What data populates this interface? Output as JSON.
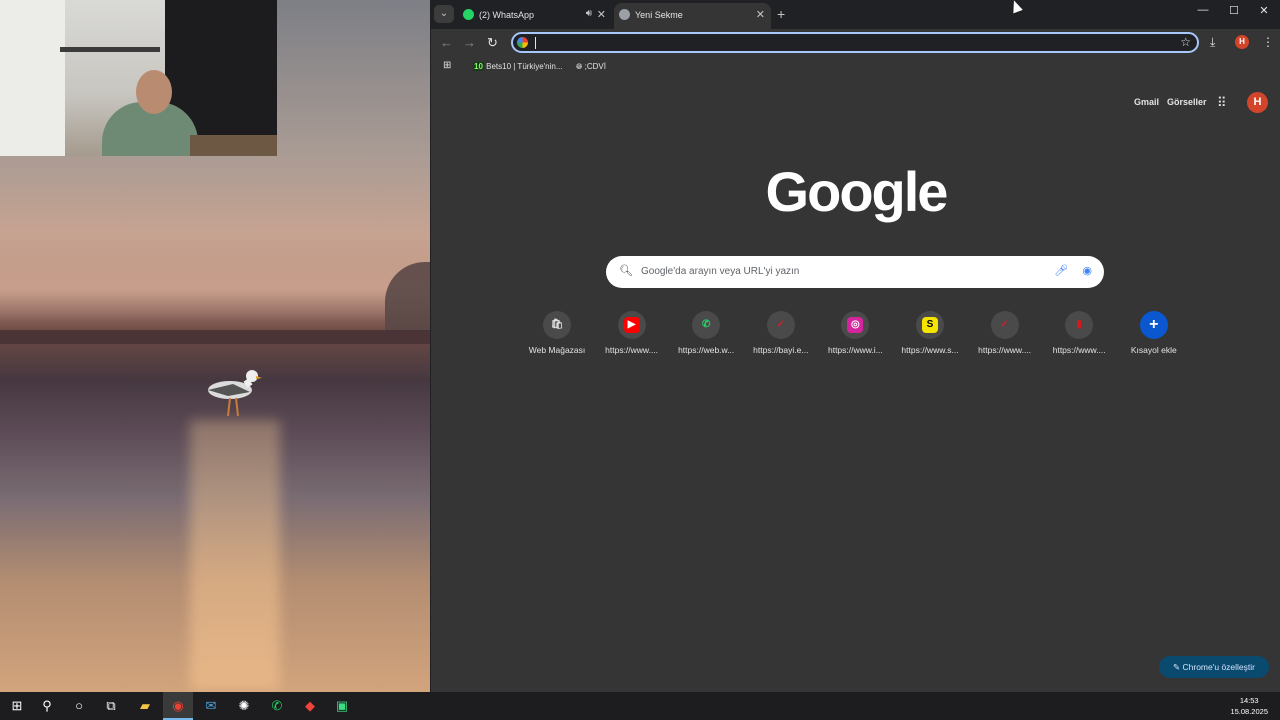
{
  "tabs": [
    {
      "title": "(2) WhatsApp",
      "icon": "whatsapp-icon",
      "audio": true
    },
    {
      "title": "Yeni Sekme",
      "icon": "chrome-icon",
      "active": true
    }
  ],
  "window_controls": {
    "minimize": "—",
    "maximize": "☐",
    "close": "✕"
  },
  "bookmarks": [
    {
      "icon": "10",
      "label": "Bets10 | Türkiye'nin..."
    },
    {
      "icon": "globe-icon",
      "label": ";CDVİ"
    }
  ],
  "top_links": {
    "gmail": "Gmail",
    "images": "Görseller",
    "profile_initial": "H"
  },
  "logo": "Google",
  "search": {
    "placeholder": "Google'da arayın veya URL'yi yazın"
  },
  "shortcuts": [
    {
      "label": "Web Mağazası",
      "icon": "web-store-icon",
      "glyph": "🛍",
      "color": "#e0e0e0"
    },
    {
      "label": "https://www....",
      "icon": "youtube-icon",
      "glyph": "▶",
      "color": "#ff0000"
    },
    {
      "label": "https://web.w...",
      "icon": "whatsapp-icon",
      "glyph": "✆",
      "color": "#25d366"
    },
    {
      "label": "https://bayi.e...",
      "icon": "checkmark-icon",
      "glyph": "✓",
      "color": "#c0272d"
    },
    {
      "label": "https://www.i...",
      "icon": "instagram-icon",
      "glyph": "◎",
      "color": "#d6249f"
    },
    {
      "label": "https://www.s...",
      "icon": "s-logo-icon",
      "glyph": "S",
      "color": "#f5e400"
    },
    {
      "label": "https://www....",
      "icon": "checkmark-icon",
      "glyph": "✓",
      "color": "#c0272d"
    },
    {
      "label": "https://www....",
      "icon": "red-square-icon",
      "glyph": "▮",
      "color": "#d41b1b"
    },
    {
      "label": "Kısayol ekle",
      "icon": "plus-icon",
      "glyph": "+",
      "color": "#0b57d0"
    }
  ],
  "customize_button": "Chrome'u özelleştir",
  "taskbar": {
    "items": [
      "windows-start-icon",
      "search-icon",
      "cortana-icon",
      "task-view-icon",
      "file-explorer-icon",
      "chrome-icon",
      "mail-icon",
      "chatgpt-icon",
      "whatsapp-icon",
      "anydesk-icon",
      "android-icon"
    ],
    "time": "14:53",
    "date": "15.08.2025"
  },
  "colors": {
    "accent": "#a8c7fa",
    "background": "#353535",
    "profile": "#d2452b"
  }
}
